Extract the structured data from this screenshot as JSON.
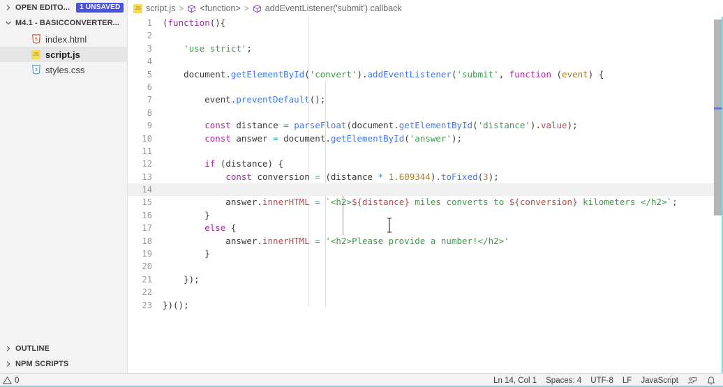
{
  "sidebar": {
    "open_editors": {
      "label": "OPEN EDITO...",
      "badge": "1 UNSAVED",
      "chevron": "chevron-right-icon"
    },
    "folder": {
      "label": "M4.1 - BASICCONVERTER...",
      "chevron": "chevron-down-icon"
    },
    "files": [
      {
        "name": "index.html",
        "icon": "html5-file-icon",
        "selected": false
      },
      {
        "name": "script.js",
        "icon": "javascript-file-icon",
        "selected": true
      },
      {
        "name": "styles.css",
        "icon": "css3-file-icon",
        "selected": false
      }
    ],
    "sections": [
      {
        "label": "OUTLINE",
        "chevron": "chevron-right-icon"
      },
      {
        "label": "NPM SCRIPTS",
        "chevron": "chevron-right-icon"
      }
    ]
  },
  "breadcrumb": {
    "file_icon": "javascript-file-icon",
    "items": [
      {
        "label": "script.js",
        "icon": null
      },
      {
        "label": "<function>",
        "icon": "symbol-function-icon"
      },
      {
        "label": "addEventListener('submit') callback",
        "icon": "symbol-function-icon"
      }
    ],
    "separator": ">"
  },
  "editor": {
    "language": "JavaScript",
    "active_line": 14,
    "first_line": 1,
    "last_line": 23,
    "lines": [
      {
        "n": 1,
        "tokens": [
          {
            "t": "(",
            "c": "p"
          },
          {
            "t": "function",
            "c": "k"
          },
          {
            "t": "(){",
            "c": "p"
          }
        ]
      },
      {
        "n": 2,
        "tokens": []
      },
      {
        "n": 3,
        "tokens": [
          {
            "t": "    ",
            "c": "p"
          },
          {
            "t": "'use strict'",
            "c": "s"
          },
          {
            "t": ";",
            "c": "p"
          }
        ]
      },
      {
        "n": 4,
        "tokens": []
      },
      {
        "n": 5,
        "tokens": [
          {
            "t": "    document",
            "c": "p"
          },
          {
            "t": ".",
            "c": "p"
          },
          {
            "t": "getElementById",
            "c": "fn"
          },
          {
            "t": "(",
            "c": "p"
          },
          {
            "t": "'convert'",
            "c": "s"
          },
          {
            "t": ").",
            "c": "p"
          },
          {
            "t": "addEventListener",
            "c": "fn"
          },
          {
            "t": "(",
            "c": "p"
          },
          {
            "t": "'submit'",
            "c": "s"
          },
          {
            "t": ", ",
            "c": "p"
          },
          {
            "t": "function",
            "c": "k"
          },
          {
            "t": " (",
            "c": "p"
          },
          {
            "t": "event",
            "c": "v"
          },
          {
            "t": ") {",
            "c": "p"
          }
        ]
      },
      {
        "n": 6,
        "tokens": []
      },
      {
        "n": 7,
        "tokens": [
          {
            "t": "        event",
            "c": "p"
          },
          {
            "t": ".",
            "c": "p"
          },
          {
            "t": "preventDefault",
            "c": "fn"
          },
          {
            "t": "();",
            "c": "p"
          }
        ]
      },
      {
        "n": 8,
        "tokens": []
      },
      {
        "n": 9,
        "tokens": [
          {
            "t": "        ",
            "c": "p"
          },
          {
            "t": "const",
            "c": "k"
          },
          {
            "t": " distance ",
            "c": "p"
          },
          {
            "t": "=",
            "c": "op"
          },
          {
            "t": " ",
            "c": "p"
          },
          {
            "t": "parseFloat",
            "c": "fn"
          },
          {
            "t": "(document.",
            "c": "p"
          },
          {
            "t": "getElementById",
            "c": "fn"
          },
          {
            "t": "(",
            "c": "p"
          },
          {
            "t": "'distance'",
            "c": "s"
          },
          {
            "t": ").",
            "c": "p"
          },
          {
            "t": "value",
            "c": "prop"
          },
          {
            "t": ");",
            "c": "p"
          }
        ]
      },
      {
        "n": 10,
        "tokens": [
          {
            "t": "        ",
            "c": "p"
          },
          {
            "t": "const",
            "c": "k"
          },
          {
            "t": " answer ",
            "c": "p"
          },
          {
            "t": "=",
            "c": "op"
          },
          {
            "t": " document.",
            "c": "p"
          },
          {
            "t": "getElementById",
            "c": "fn"
          },
          {
            "t": "(",
            "c": "p"
          },
          {
            "t": "'answer'",
            "c": "s"
          },
          {
            "t": ");",
            "c": "p"
          }
        ]
      },
      {
        "n": 11,
        "tokens": []
      },
      {
        "n": 12,
        "tokens": [
          {
            "t": "        ",
            "c": "p"
          },
          {
            "t": "if",
            "c": "k"
          },
          {
            "t": " (distance) {",
            "c": "p"
          }
        ]
      },
      {
        "n": 13,
        "tokens": [
          {
            "t": "            ",
            "c": "p"
          },
          {
            "t": "const",
            "c": "k"
          },
          {
            "t": " conversion ",
            "c": "p"
          },
          {
            "t": "=",
            "c": "op"
          },
          {
            "t": " (distance ",
            "c": "p"
          },
          {
            "t": "*",
            "c": "op"
          },
          {
            "t": " ",
            "c": "p"
          },
          {
            "t": "1.609344",
            "c": "num"
          },
          {
            "t": ").",
            "c": "p"
          },
          {
            "t": "toFixed",
            "c": "fn"
          },
          {
            "t": "(",
            "c": "p"
          },
          {
            "t": "3",
            "c": "num"
          },
          {
            "t": ");",
            "c": "p"
          }
        ]
      },
      {
        "n": 14,
        "tokens": []
      },
      {
        "n": 15,
        "tokens": [
          {
            "t": "            answer",
            "c": "p"
          },
          {
            "t": ".",
            "c": "p"
          },
          {
            "t": "innerHTML",
            "c": "prop"
          },
          {
            "t": " ",
            "c": "p"
          },
          {
            "t": "=",
            "c": "op"
          },
          {
            "t": " ",
            "c": "p"
          },
          {
            "t": "`<h2>",
            "c": "s"
          },
          {
            "t": "${distance}",
            "c": "prop"
          },
          {
            "t": " miles converts to ",
            "c": "s"
          },
          {
            "t": "${conversion}",
            "c": "prop"
          },
          {
            "t": " kilometers </h2>`",
            "c": "s"
          },
          {
            "t": ";",
            "c": "p"
          }
        ]
      },
      {
        "n": 16,
        "tokens": [
          {
            "t": "        }",
            "c": "p"
          }
        ]
      },
      {
        "n": 17,
        "tokens": [
          {
            "t": "        ",
            "c": "p"
          },
          {
            "t": "else",
            "c": "k"
          },
          {
            "t": " {",
            "c": "p"
          }
        ]
      },
      {
        "n": 18,
        "tokens": [
          {
            "t": "            answer",
            "c": "p"
          },
          {
            "t": ".",
            "c": "p"
          },
          {
            "t": "innerHTML",
            "c": "prop"
          },
          {
            "t": " ",
            "c": "p"
          },
          {
            "t": "=",
            "c": "op"
          },
          {
            "t": " ",
            "c": "p"
          },
          {
            "t": "'<h2>Please provide a number!</h2>'",
            "c": "s"
          }
        ]
      },
      {
        "n": 19,
        "tokens": [
          {
            "t": "        }",
            "c": "p"
          }
        ]
      },
      {
        "n": 20,
        "tokens": []
      },
      {
        "n": 21,
        "tokens": [
          {
            "t": "    });",
            "c": "p"
          }
        ]
      },
      {
        "n": 22,
        "tokens": []
      },
      {
        "n": 23,
        "tokens": [
          {
            "t": "})();",
            "c": "p"
          }
        ]
      }
    ]
  },
  "status_bar": {
    "problems": {
      "icon": "warning-triangle-icon",
      "count": "0"
    },
    "position": "Ln 14, Col 1",
    "indentation": "Spaces: 4",
    "encoding": "UTF-8",
    "eol": "LF",
    "language": "JavaScript",
    "feedback_icon": "feedback-person-screen-icon",
    "notifications_icon": "bell-icon"
  },
  "colors": {
    "accent_badge": "#4a52e0",
    "accent_edge": "#7fd8dc",
    "sidebar_bg": "#f3f3f3",
    "editor_bg": "#ffffff",
    "active_line": "#f0f0f0",
    "keyword": "#a626a4",
    "function": "#4078f2",
    "string": "#3f9a4c",
    "number": "#b07d20",
    "property": "#c1494b",
    "operator": "#1aacad"
  }
}
